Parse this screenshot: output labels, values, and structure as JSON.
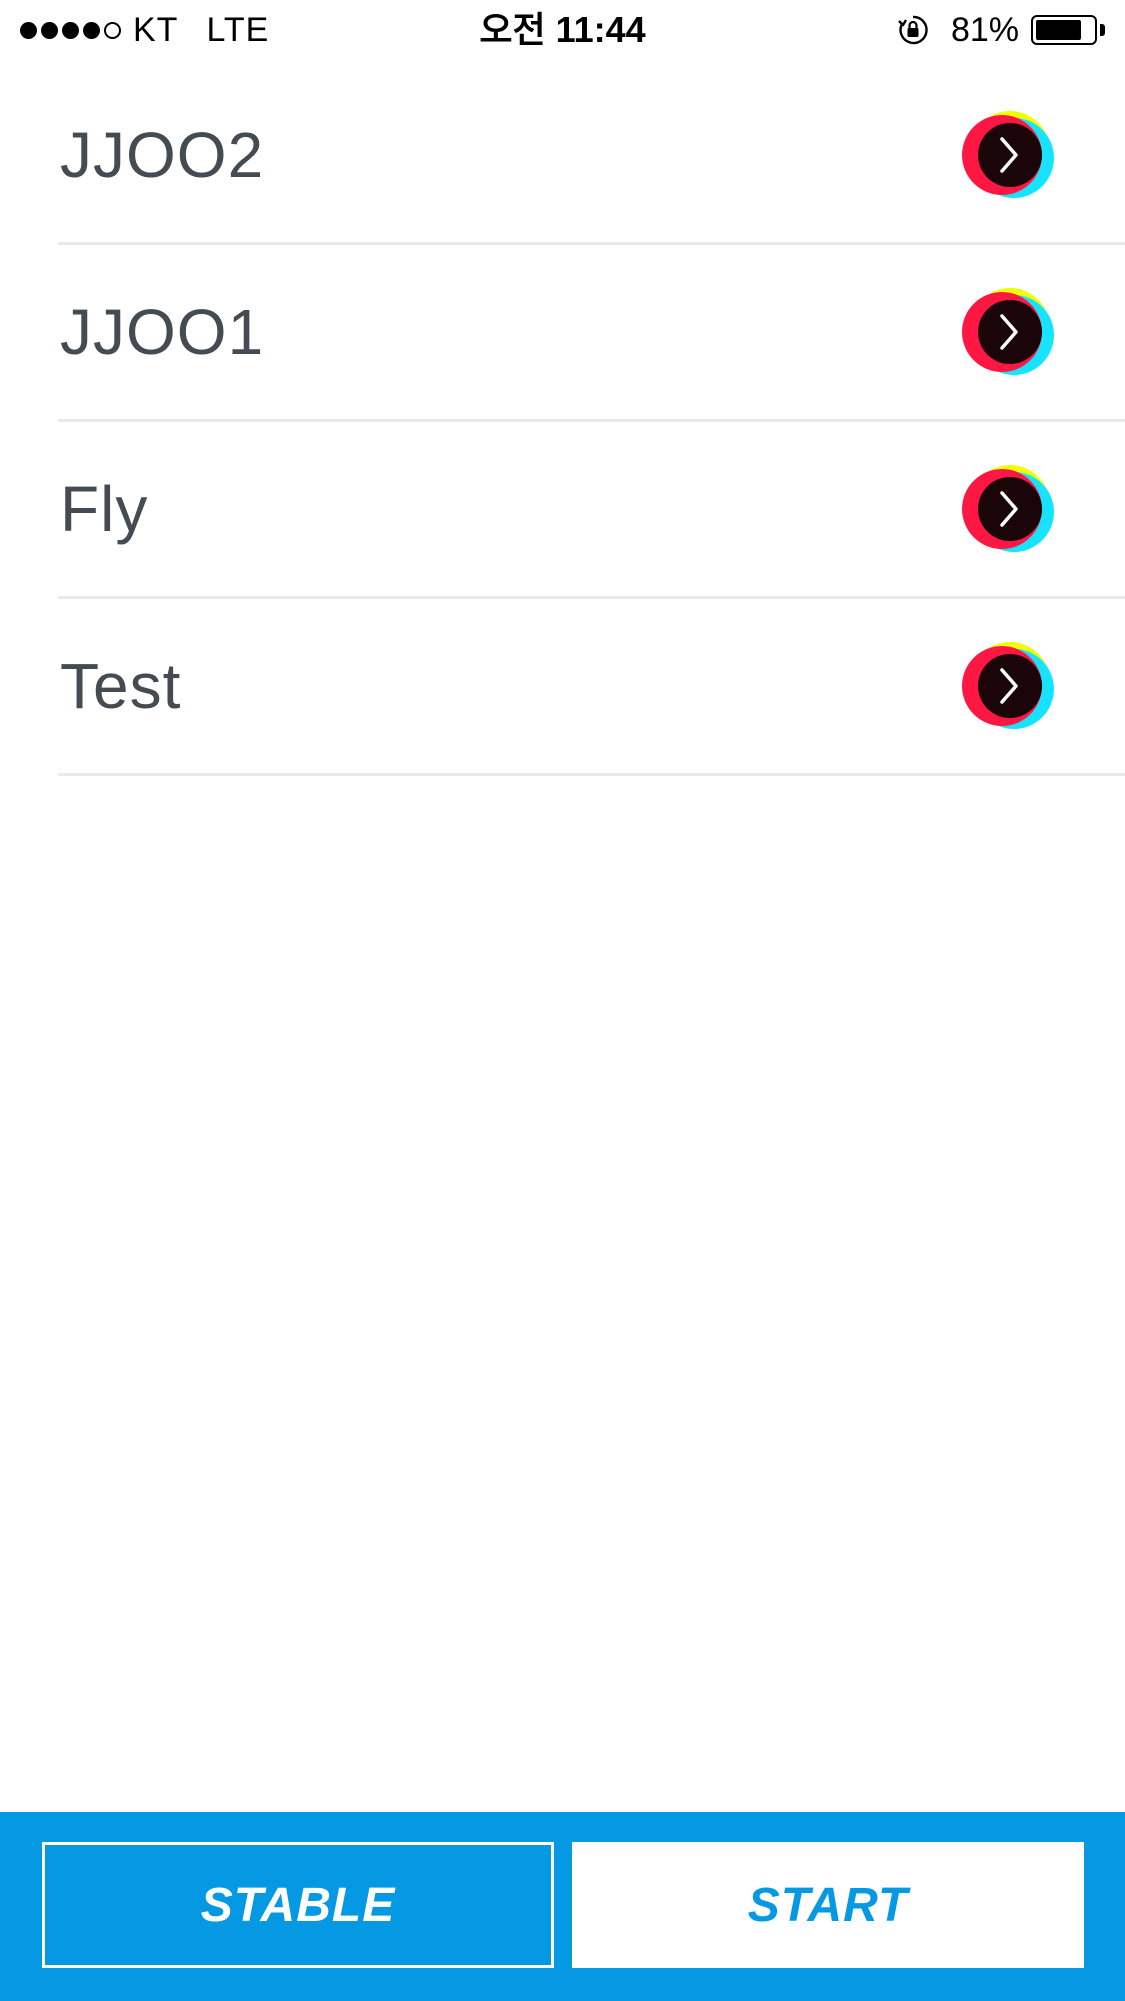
{
  "status_bar": {
    "carrier": "KT",
    "network": "LTE",
    "time": "오전 11:44",
    "battery": "81%",
    "battery_level": 0.81,
    "signal_bars_filled": 4,
    "signal_bars_total": 5,
    "icons": {
      "orientation_lock": "orientation-lock-icon",
      "battery": "battery-icon"
    }
  },
  "list": {
    "items": [
      {
        "label": "JJOO2",
        "action_icon": "chevron-right-icon"
      },
      {
        "label": "JJOO1",
        "action_icon": "chevron-right-icon"
      },
      {
        "label": "Fly",
        "action_icon": "chevron-right-icon"
      },
      {
        "label": "Test",
        "action_icon": "chevron-right-icon"
      }
    ]
  },
  "bottom_bar": {
    "stable_label": "STABLE",
    "start_label": "START"
  },
  "colors": {
    "accent": "#0699e3",
    "text": "#454b52",
    "divider": "#e9eaea",
    "button_ring_red": "#ff1744",
    "button_ring_cyan": "#18e3ff",
    "button_ring_yellow": "#f2ff00",
    "button_core": "#1a0508"
  }
}
